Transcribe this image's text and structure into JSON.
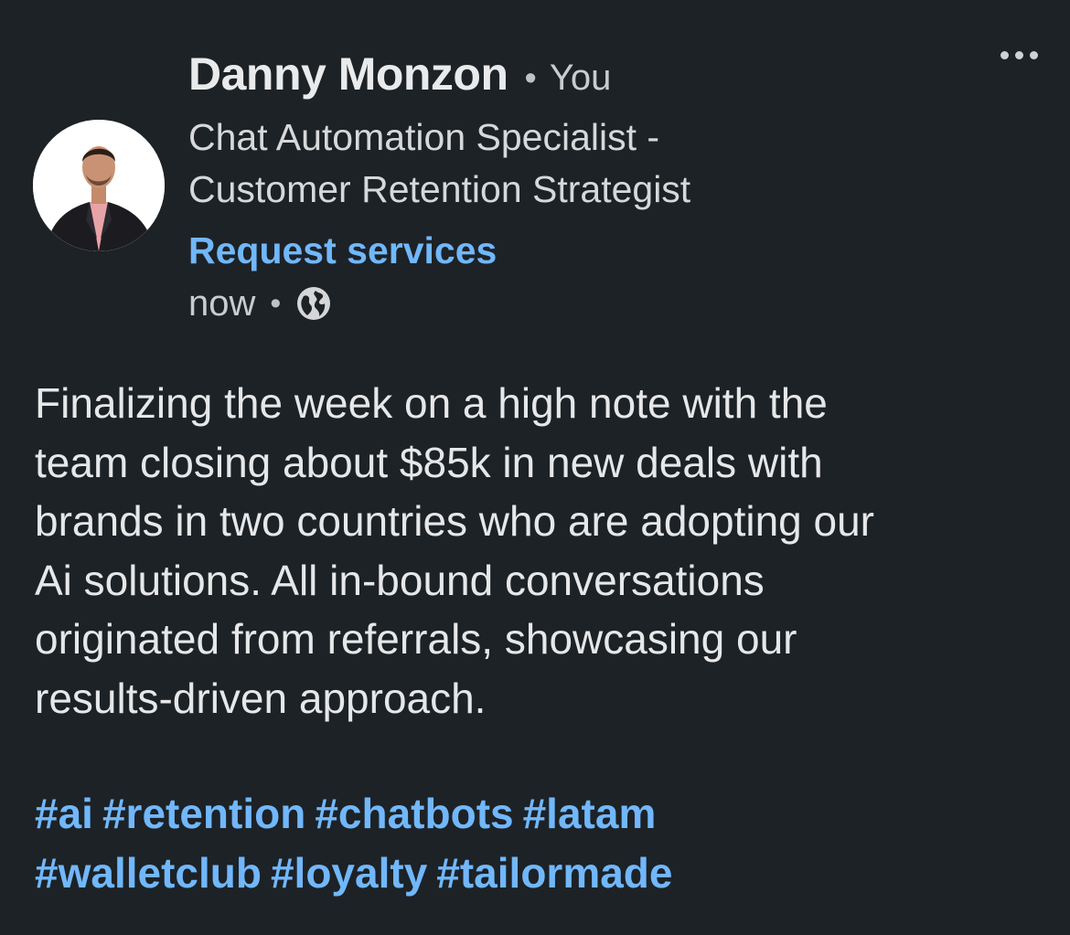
{
  "author": {
    "name": "Danny Monzon",
    "separator": "•",
    "degree": "You",
    "headline_lines": [
      "Chat Automation Specialist -",
      "Customer Retention Strategist"
    ],
    "action_link": "Request services",
    "timestamp": "now",
    "timestamp_separator": "•",
    "visibility_icon": "globe-icon"
  },
  "menu": {
    "icon": "more-options-icon"
  },
  "post": {
    "lines": [
      "Finalizing the week on a high note with the",
      "team closing about $85k in new deals with",
      "brands in two countries who are adopting our",
      "Ai solutions. All in-bound conversations",
      "originated from referrals, showcasing our",
      "results-driven approach."
    ],
    "hashtag_lines": [
      [
        "#ai",
        "#retention",
        "#chatbots",
        "#latam"
      ],
      [
        "#walletclub",
        "#loyalty",
        "#tailormade"
      ]
    ]
  },
  "colors": {
    "background": "#1d2226",
    "link": "#71b7fb",
    "text": "#e6e7e8"
  }
}
